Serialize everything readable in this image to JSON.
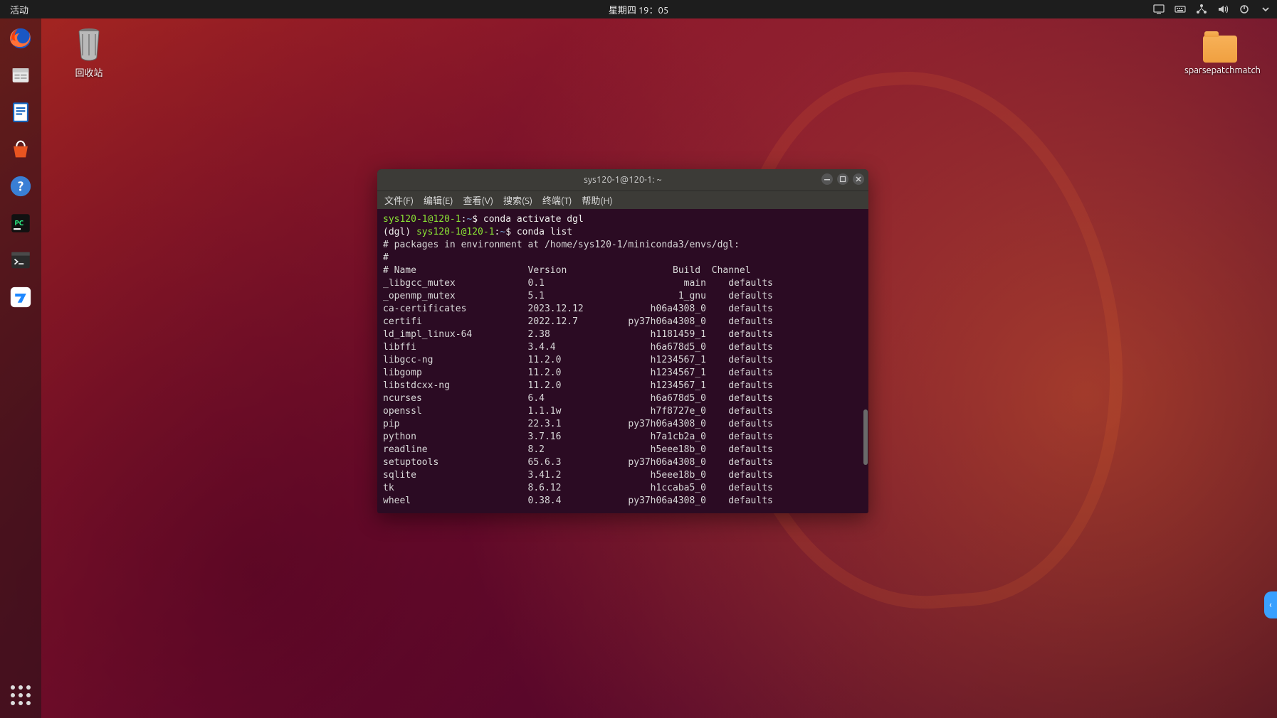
{
  "topbar": {
    "activities": "活动",
    "clock": "星期四 19：05"
  },
  "desktop": {
    "trash_label": "回收站",
    "folder_label": "sparsepatchmatch"
  },
  "terminal": {
    "title": "sys120-1@120-1: ~",
    "menus": [
      "文件(F)",
      "编辑(E)",
      "查看(V)",
      "搜索(S)",
      "终端(T)",
      "帮助(H)"
    ],
    "prompt1_user": "sys120-1@120-1",
    "prompt1_cmd": "conda activate dgl",
    "prompt2_env": "(dgl) ",
    "prompt2_user": "sys120-1@120-1",
    "prompt2_cmd": "conda list",
    "env_comment": "# packages in environment at /home/sys120-1/miniconda3/envs/dgl:",
    "hash_line": "#",
    "header": "# Name                    Version                   Build  Channel",
    "packages": [
      {
        "name": "_libgcc_mutex",
        "version": "0.1",
        "build": "main",
        "channel": "defaults"
      },
      {
        "name": "_openmp_mutex",
        "version": "5.1",
        "build": "1_gnu",
        "channel": "defaults"
      },
      {
        "name": "ca-certificates",
        "version": "2023.12.12",
        "build": "h06a4308_0",
        "channel": "defaults"
      },
      {
        "name": "certifi",
        "version": "2022.12.7",
        "build": "py37h06a4308_0",
        "channel": "defaults"
      },
      {
        "name": "ld_impl_linux-64",
        "version": "2.38",
        "build": "h1181459_1",
        "channel": "defaults"
      },
      {
        "name": "libffi",
        "version": "3.4.4",
        "build": "h6a678d5_0",
        "channel": "defaults"
      },
      {
        "name": "libgcc-ng",
        "version": "11.2.0",
        "build": "h1234567_1",
        "channel": "defaults"
      },
      {
        "name": "libgomp",
        "version": "11.2.0",
        "build": "h1234567_1",
        "channel": "defaults"
      },
      {
        "name": "libstdcxx-ng",
        "version": "11.2.0",
        "build": "h1234567_1",
        "channel": "defaults"
      },
      {
        "name": "ncurses",
        "version": "6.4",
        "build": "h6a678d5_0",
        "channel": "defaults"
      },
      {
        "name": "openssl",
        "version": "1.1.1w",
        "build": "h7f8727e_0",
        "channel": "defaults"
      },
      {
        "name": "pip",
        "version": "22.3.1",
        "build": "py37h06a4308_0",
        "channel": "defaults"
      },
      {
        "name": "python",
        "version": "3.7.16",
        "build": "h7a1cb2a_0",
        "channel": "defaults"
      },
      {
        "name": "readline",
        "version": "8.2",
        "build": "h5eee18b_0",
        "channel": "defaults"
      },
      {
        "name": "setuptools",
        "version": "65.6.3",
        "build": "py37h06a4308_0",
        "channel": "defaults"
      },
      {
        "name": "sqlite",
        "version": "3.41.2",
        "build": "h5eee18b_0",
        "channel": "defaults"
      },
      {
        "name": "tk",
        "version": "8.6.12",
        "build": "h1ccaba5_0",
        "channel": "defaults"
      },
      {
        "name": "wheel",
        "version": "0.38.4",
        "build": "py37h06a4308_0",
        "channel": "defaults"
      }
    ]
  }
}
